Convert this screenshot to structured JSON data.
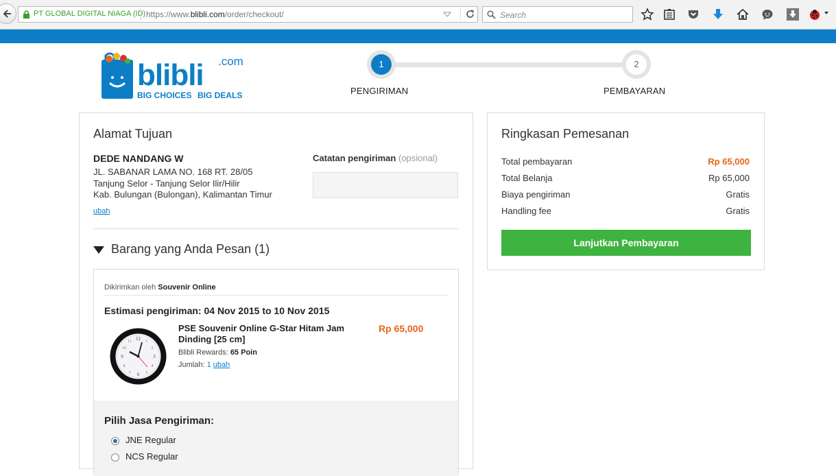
{
  "browser": {
    "site_identity": "PT GLOBAL DIGITAL NIAGA (ID)",
    "url_prefix": "https://www.",
    "url_domain": "blibli.com",
    "url_path": "/order/checkout/",
    "search_placeholder": "Search"
  },
  "header": {
    "steps": [
      {
        "number": "1",
        "label": "PENGIRIMAN",
        "active": true
      },
      {
        "number": "2",
        "label": "PEMBAYARAN",
        "active": false
      }
    ],
    "logo": {
      "brand": "blibli",
      "suffix": ".com",
      "tag1": "BIG CHOICES",
      "tag2": "BIG DEALS"
    }
  },
  "address": {
    "title": "Alamat Tujuan",
    "name": "DEDE NANDANG W",
    "lines": [
      "JL. SABANAR LAMA NO. 168 RT. 28/05",
      "Tanjung Selor - Tanjung Selor Ilir/Hilir",
      "Kab. Bulungan (Bulongan), Kalimantan Timur"
    ],
    "change_link": "ubah",
    "notes_label": "Catatan pengiriman",
    "notes_optional": "(opsional)",
    "notes_value": ""
  },
  "items": {
    "title": "Barang yang Anda Pesan (1)",
    "seller_prefix": "Dikirimkan oleh",
    "seller_name": "Souvenir Online",
    "estimate": "Estimasi pengiriman: 04 Nov 2015 to 10 Nov 2015",
    "product": {
      "name": "PSE Souvenir Online G-Star Hitam Jam Dinding [25 cm]",
      "price": "Rp 65,000",
      "rewards_label": "Blibli Rewards:",
      "rewards_value": "65 Poin",
      "qty_label": "Jumlah:",
      "qty_value": "1",
      "change_link": "ubah"
    },
    "shipping": {
      "title": "Pilih Jasa Pengiriman:",
      "options": [
        {
          "label": "JNE Regular",
          "selected": true
        },
        {
          "label": "NCS Regular",
          "selected": false
        }
      ]
    }
  },
  "summary": {
    "title": "Ringkasan Pemesanan",
    "rows": [
      {
        "label": "Total pembayaran",
        "value": "Rp 65,000",
        "highlight": true
      },
      {
        "label": "Total Belanja",
        "value": "Rp 65,000",
        "highlight": false
      },
      {
        "label": "Biaya pengiriman",
        "value": "Gratis",
        "highlight": false
      },
      {
        "label": "Handling fee",
        "value": "Gratis",
        "highlight": false
      }
    ],
    "button_label": "Lanjutkan Pembayaran"
  },
  "colors": {
    "brand_blue": "#0d7ec6",
    "accent_orange": "#e8661b",
    "button_green": "#3fb33f"
  }
}
